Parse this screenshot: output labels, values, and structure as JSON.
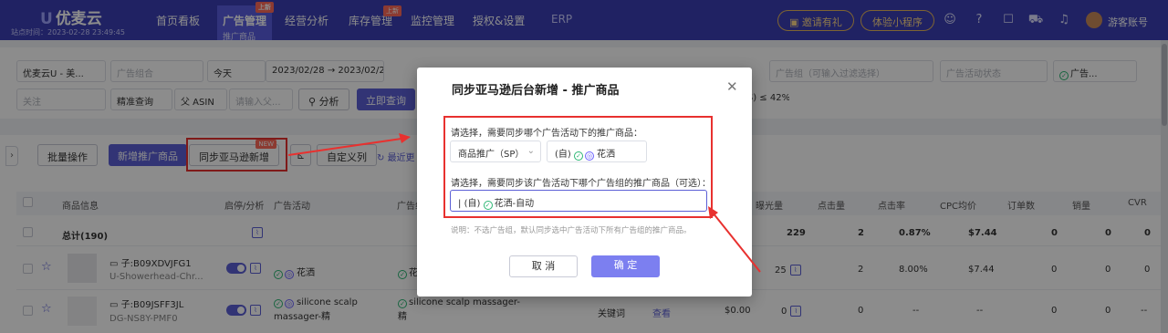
{
  "header": {
    "brand": "优麦云",
    "site_time": "站点时间：2023-02-28 23:49:45",
    "nav": [
      {
        "label": "首页看板"
      },
      {
        "label": "广告管理",
        "sub": "推广商品",
        "badge": "上新"
      },
      {
        "label": "经营分析"
      },
      {
        "label": "库存管理",
        "badge": "上新"
      },
      {
        "label": "监控管理"
      },
      {
        "label": "授权&设置"
      },
      {
        "label": "ERP"
      }
    ],
    "invite_button": "邀请有礼",
    "miniapp_button": "体验小程序",
    "username": "游客账号"
  },
  "filters": {
    "shop": "优麦云U - 美...",
    "ad_group_placeholder": "广告组合",
    "date_preset": "今天",
    "date_start": "2023/02/28",
    "date_sep": "→",
    "date_end": "2023/02/28",
    "ad_group_filter_placeholder": "广告组（可输入过滤选择）",
    "campaign_status_placeholder": "广告活动状态",
    "ad_status": "广告...",
    "follow_placeholder": "关注",
    "match": "精准查询",
    "parent_asin": "父 ASIN",
    "input_placeholder": "请输入父...",
    "analysis_button": "分析",
    "query_button": "立即查询",
    "acos_tag": "OS) ≤ 42%"
  },
  "toolbar": {
    "batch": "批量操作",
    "add_product": "新增推广商品",
    "sync": "同步亚马逊新增",
    "sync_badge": "NEW",
    "custom_columns": "自定义列",
    "recent": "最近更"
  },
  "table": {
    "headers": [
      "商品信息",
      "启停/分析",
      "广告活动",
      "广告组",
      "曝光量",
      "点击量",
      "点击率",
      "CPC均价",
      "订单数",
      "销量",
      "CVR"
    ],
    "total_row": {
      "label": "总计(190)",
      "impressions": "229",
      "clicks": "2",
      "ctr": "0.87%",
      "cpc": "$7.44",
      "orders": "0",
      "sales": "0",
      "cvr": "0"
    },
    "rows": [
      {
        "asin": "子:B09XDVJFG1",
        "sku": "U-Showerhead-Chr...",
        "campaign": "花洒",
        "ad_group": "花",
        "impressions": "25",
        "clicks": "2",
        "ctr": "8.00%",
        "cpc": "$7.44",
        "orders": "0",
        "sales": "0",
        "cvr": "0"
      },
      {
        "asin": "子:B09JSFF3JL",
        "sku": "DG-NS8Y-PMF0",
        "campaign": "silicone scalp massager-精",
        "ad_group": "silicone scalp massager-精",
        "targeting": "关键词",
        "view": "查看",
        "spend": "$0.00",
        "impressions": "0",
        "clicks": "0",
        "ctr": "--",
        "cpc": "--",
        "orders": "0",
        "sales": "0",
        "cvr": "--"
      }
    ]
  },
  "modal": {
    "title": "同步亚马逊后台新增 - 推广商品",
    "q1": "请选择，需要同步哪个广告活动下的推广商品：",
    "ad_type": "商品推广（SP）",
    "campaign": "(自)",
    "campaign_name": "花洒",
    "q2": "请选择，需要同步该广告活动下哪个广告组的推广商品（可选）：",
    "ad_group": "(自)",
    "ad_group_name": "花洒-自动",
    "note": "说明：不选广告组，默认同步选中广告活动下所有广告组的推广商品。",
    "cancel": "取 消",
    "confirm": "确 定"
  },
  "colors": {
    "primary": "#5b5fd6",
    "nav_bg": "#3b3fb4",
    "highlight": "#e8312f"
  }
}
